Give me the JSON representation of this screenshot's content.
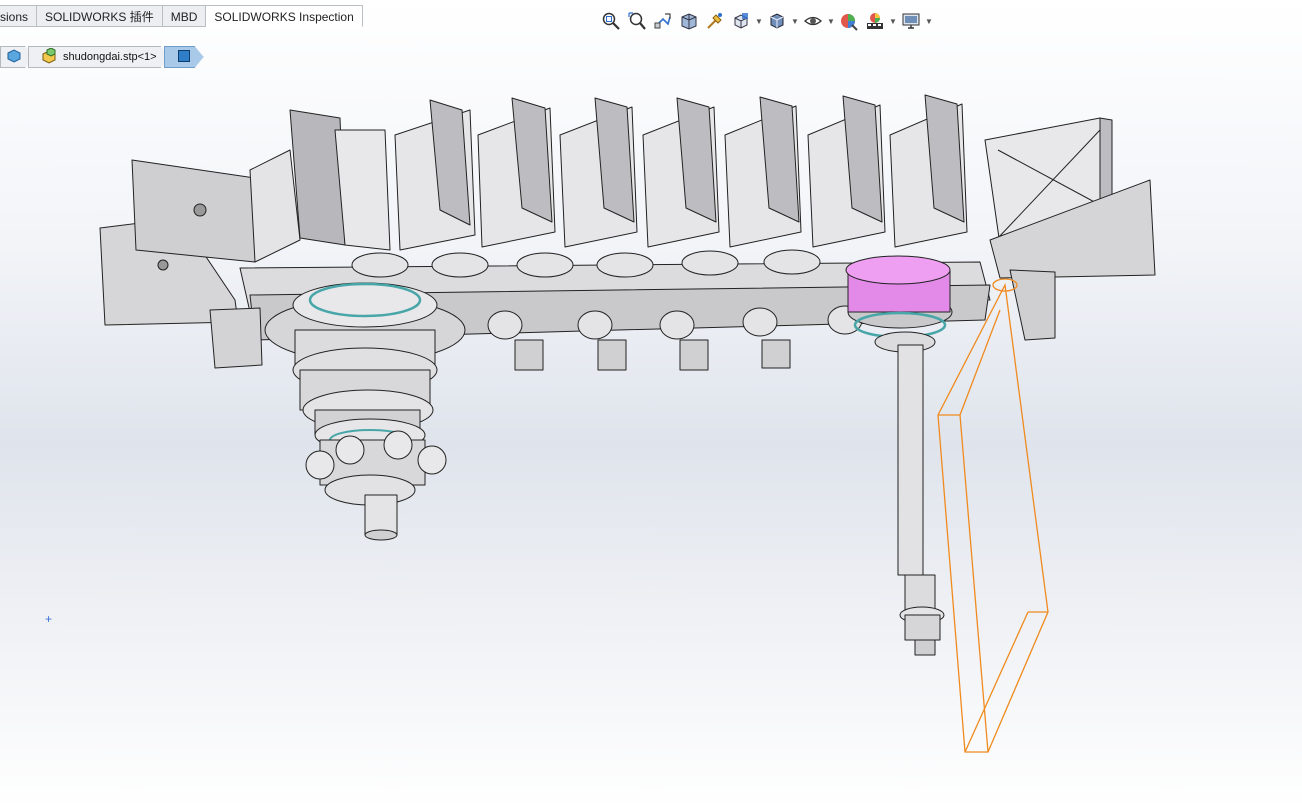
{
  "tabs": [
    {
      "label": "sions"
    },
    {
      "label": "SOLIDWORKS 插件"
    },
    {
      "label": "MBD"
    },
    {
      "label": "SOLIDWORKS Inspection"
    }
  ],
  "breadcrumb": {
    "part_label": "shudongdai.stp<1>"
  },
  "heads_up_icons": [
    "zoom-to-fit-icon",
    "zoom-to-area-icon",
    "previous-view-icon",
    "section-view-icon",
    "dynamic-annotation-icon",
    "view-orientation-icon",
    "display-style-icon",
    "hide-show-items-icon",
    "edit-appearance-icon",
    "apply-scene-icon",
    "view-settings-icon"
  ],
  "colors": {
    "model_body": "#d9d9db",
    "highlight_part": "#e38ae8",
    "selection_outline": "#f08a1e",
    "bearing_ring": "#48a6a8",
    "breadcrumb_selected": "#a9c9e8"
  },
  "origin_marker": "+"
}
